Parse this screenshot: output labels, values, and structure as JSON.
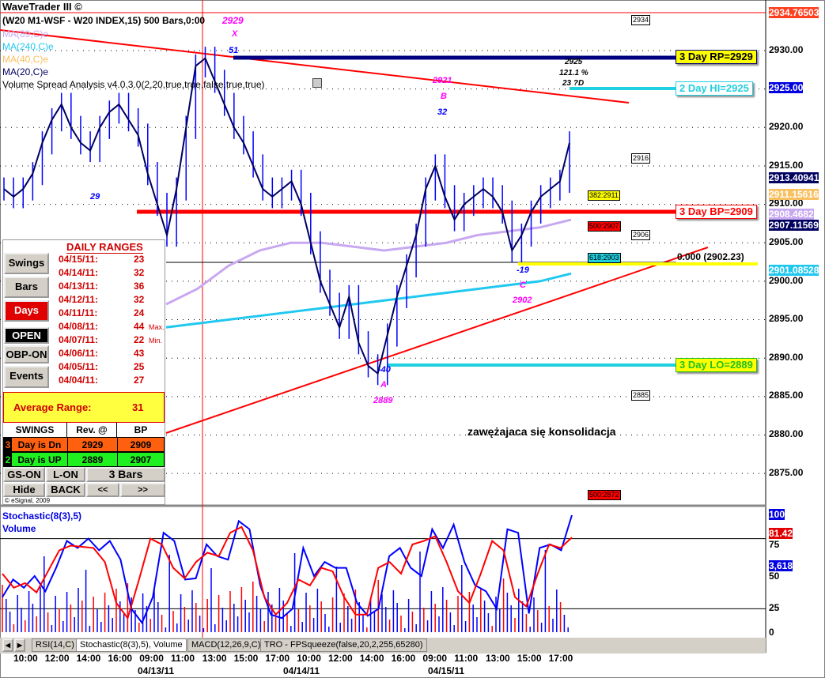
{
  "header": {
    "app_title": "WaveTrader III ©",
    "symbol_line": "(W20 M1-WSF - W20 INDEX,15) 500 Bars,0:00",
    "symbol_value": "2929"
  },
  "indicators": {
    "ma89": "MA(89,C)e",
    "ma240": "MA(240,C)e",
    "ma40": "MA(40,C)e",
    "ma20": "MA(20,C)e",
    "vsa": "Volume Spread Analysis v4.0.3.0(2,20,true,true,false,true,true)"
  },
  "colors": {
    "ma89": "#c8a8f0",
    "ma240": "#20c8f0",
    "ma40": "#f8c060",
    "ma20": "#000060",
    "price": "#0000ff"
  },
  "price_axis": {
    "labels": [
      "2930.00",
      "2925.00",
      "2920.00",
      "2915.00",
      "2910.00",
      "2905.00",
      "2900.00",
      "2895.00",
      "2890.00",
      "2885.00",
      "2880.00",
      "2875.00"
    ],
    "badges": {
      "top": "2934.76503",
      "hi": "2925.00",
      "ma20": "2913.40941",
      "ma40": "2911.15616",
      "ma89": "2908.4682",
      "last": "2907.11569",
      "ma240": "2901.08528"
    }
  },
  "levels": {
    "rp": "3 Day RP=2929",
    "hi": "2 Day HI=2925",
    "bp": "3 Day BP=2909",
    "lo": "3 Day LO=2889"
  },
  "fib": {
    "f382": "382:2911",
    "f500": "500:2907",
    "f618": "618:2903",
    "f500b": "500:2872",
    "zero": "0.000  (2902.23)"
  },
  "boxes": {
    "b2934": "2934",
    "b2916": "2916",
    "b2906": "2906",
    "b2885": "2885"
  },
  "waves": {
    "x": "X",
    "x_val": "2929",
    "x_count": "51",
    "b": "B",
    "b_val": "2921",
    "b_count": "32",
    "a": "A",
    "a_val": "2889",
    "a_count": "-40",
    "c": "C",
    "c_val": "2902",
    "c_count": "-19",
    "left_count": "29",
    "proj_price": "2925",
    "proj_pct": "121.1 %",
    "proj_bars": "23 ?D"
  },
  "annotation": "zawężajaca się konsolidacja",
  "panel": {
    "buttons": {
      "swings": "Swings",
      "bars": "Bars",
      "days": "Days",
      "open": "OPEN",
      "obp": "OBP-ON",
      "events": "Events"
    },
    "title": "DAILY RANGES",
    "ranges": [
      {
        "date": "04/15/11:",
        "value": "23",
        "note": ""
      },
      {
        "date": "04/14/11:",
        "value": "32",
        "note": ""
      },
      {
        "date": "04/13/11:",
        "value": "36",
        "note": ""
      },
      {
        "date": "04/12/11:",
        "value": "32",
        "note": ""
      },
      {
        "date": "04/11/11:",
        "value": "24",
        "note": ""
      },
      {
        "date": "04/08/11:",
        "value": "44",
        "note": "Max."
      },
      {
        "date": "04/07/11:",
        "value": "22",
        "note": "Min."
      },
      {
        "date": "04/06/11:",
        "value": "43",
        "note": ""
      },
      {
        "date": "04/05/11:",
        "value": "25",
        "note": ""
      },
      {
        "date": "04/04/11:",
        "value": "27",
        "note": ""
      }
    ],
    "avg_label": "Average Range:",
    "avg_value": "31",
    "swings_head": [
      "SWINGS",
      "Rev. @",
      "BP"
    ],
    "swings": [
      {
        "n": "3",
        "label": "Day is Dn",
        "rev": "2929",
        "bp": "2909"
      },
      {
        "n": "2",
        "label": "Day is UP",
        "rev": "2889",
        "bp": "2907"
      }
    ],
    "bottom": {
      "gs": "GS-ON",
      "l": "L-ON",
      "bars": "3 Bars",
      "hide": "Hide",
      "back": "BACK",
      "prev": "<<",
      "next": ">>"
    },
    "copyright": "© eSignal, 2009"
  },
  "lower": {
    "title1": "Stochastic(8(3),5)",
    "title2": "Volume",
    "axis": [
      "75",
      "50",
      "25",
      "0"
    ],
    "badge_k": "100",
    "badge_d": "81.42",
    "badge_vol": "3,618"
  },
  "tabs": [
    "RSI(14,C)",
    "Stochastic(8(3),5), Volume",
    "MACD(12,26,9,C)",
    "TRO - FPSqueeze(false,20,2,255,65280)"
  ],
  "time_axis": {
    "times": [
      "10:00",
      "12:00",
      "14:00",
      "16:00",
      "09:00",
      "11:00",
      "13:00",
      "15:00",
      "17:00",
      "10:00",
      "12:00",
      "14:00",
      "16:00",
      "09:00",
      "11:00",
      "13:00",
      "15:00",
      "17:00"
    ],
    "dates": [
      "04/13/11",
      "04/14/11",
      "04/15/11"
    ]
  },
  "chart_data": {
    "type": "line",
    "price_close": [
      2912,
      2911,
      2912,
      2914,
      2918,
      2921,
      2923,
      2920,
      2918,
      2917,
      2920,
      2922,
      2923,
      2921,
      2919,
      2914,
      2910,
      2906,
      2912,
      2920,
      2928,
      2929,
      2926,
      2923,
      2920,
      2918,
      2915,
      2912,
      2911,
      2912,
      2913,
      2910,
      2905,
      2900,
      2897,
      2894,
      2898,
      2892,
      2889,
      2888,
      2893,
      2898,
      2902,
      2906,
      2912,
      2915,
      2911,
      2908,
      2910,
      2911,
      2912,
      2911,
      2909,
      2904,
      2906,
      2909,
      2911,
      2912,
      2913,
      2918
    ],
    "ma240": [
      2894,
      2894.5,
      2895,
      2895.5,
      2896,
      2896.5,
      2897,
      2897.5,
      2898,
      2898.5,
      2899,
      2899.5,
      2900,
      2901
    ],
    "ma89": [
      2897,
      2899,
      2902,
      2904,
      2905,
      2905,
      2904.5,
      2904,
      2904.5,
      2905,
      2906,
      2906.5,
      2907,
      2908
    ],
    "stoch_k": [
      30,
      45,
      38,
      48,
      35,
      55,
      78,
      72,
      80,
      70,
      78,
      62,
      20,
      8,
      30,
      85,
      78,
      45,
      46,
      75,
      65,
      62,
      95,
      88,
      40,
      15,
      12,
      20,
      72,
      48,
      60,
      55,
      55,
      25,
      14,
      20,
      65,
      72,
      55,
      48,
      88,
      72,
      92,
      60,
      40,
      35,
      20,
      88,
      85,
      16,
      72,
      75,
      70,
      100
    ],
    "stoch_d": [
      50,
      38,
      42,
      34,
      52,
      70,
      74,
      73,
      72,
      60,
      25,
      12,
      45,
      80,
      75,
      55,
      46,
      60,
      68,
      65,
      85,
      90,
      70,
      30,
      15,
      25,
      45,
      40,
      55,
      52,
      30,
      15,
      15,
      55,
      60,
      50,
      75,
      78,
      82,
      60,
      35,
      25,
      50,
      78,
      70,
      30,
      22,
      50,
      75,
      72,
      81
    ]
  }
}
